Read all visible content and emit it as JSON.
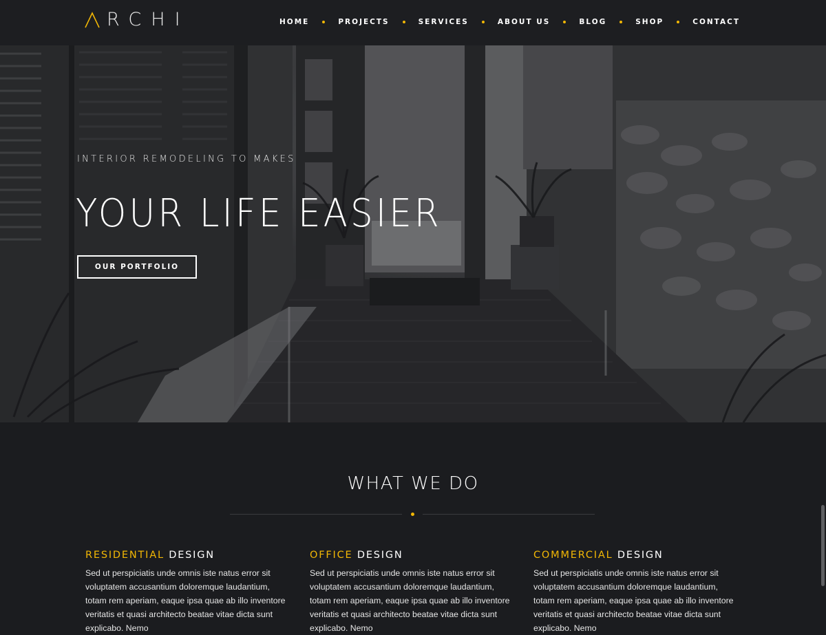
{
  "brand": {
    "name": "RCHI",
    "accent_color": "#f2b705"
  },
  "nav": {
    "items": [
      {
        "label": "HOME"
      },
      {
        "label": "PROJECTS"
      },
      {
        "label": "SERVICES"
      },
      {
        "label": "ABOUT US"
      },
      {
        "label": "BLOG"
      },
      {
        "label": "SHOP"
      },
      {
        "label": "CONTACT"
      }
    ]
  },
  "hero": {
    "subtitle": "INTERIOR REMODELING TO MAKES",
    "title": "YOUR LIFE EASIER",
    "button_label": "OUR PORTFOLIO"
  },
  "services": {
    "title": "WHAT WE DO",
    "columns": [
      {
        "accent": "RESIDENTIAL",
        "rest": " DESIGN",
        "text": "Sed ut perspiciatis unde omnis iste natus error sit voluptatem accusantium doloremque laudantium, totam rem aperiam, eaque ipsa quae ab illo inventore veritatis et quasi architecto beatae vitae dicta sunt explicabo. Nemo"
      },
      {
        "accent": "OFFICE",
        "rest": " DESIGN",
        "text": "Sed ut perspiciatis unde omnis iste natus error sit voluptatem accusantium doloremque laudantium, totam rem aperiam, eaque ipsa quae ab illo inventore veritatis et quasi architecto beatae vitae dicta sunt explicabo. Nemo"
      },
      {
        "accent": "COMMERCIAL",
        "rest": " DESIGN",
        "text": "Sed ut perspiciatis unde omnis iste natus error sit voluptatem accusantium doloremque laudantium, totam rem aperiam, eaque ipsa quae ab illo inventore veritatis et quasi architecto beatae vitae dicta sunt explicabo. Nemo"
      }
    ]
  }
}
